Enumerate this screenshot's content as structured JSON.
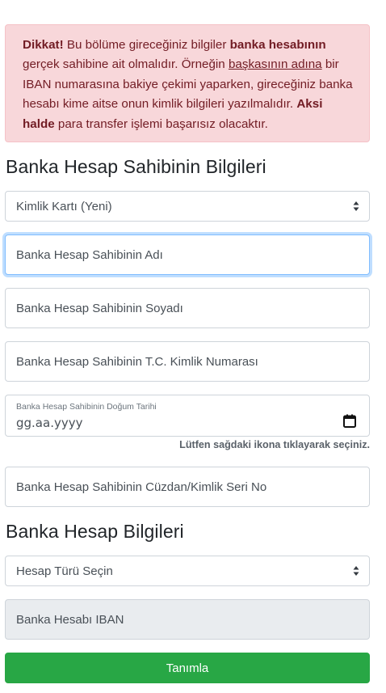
{
  "alert": {
    "lead": "Dikkat!",
    "text1": " Bu bölüme gireceğiniz bilgiler ",
    "bold1": "banka hesabının",
    "text2": " gerçek sahibine ait olmalıdır. Örneğin ",
    "underline": "başkasının adına",
    "text3": " bir IBAN numarasına bakiye çekimi yaparken, gireceğiniz banka hesabı kime aitse onun kimlik bilgileri yazılmalıdır. ",
    "bold2": "Aksi halde",
    "text4": " para transfer işlemi başarısız olacaktır."
  },
  "owner_section": {
    "title": "Banka Hesap Sahibinin Bilgileri",
    "id_type_select": "Kimlik Kartı (Yeni)",
    "first_name_placeholder": "Banka Hesap Sahibinin Adı",
    "last_name_placeholder": "Banka Hesap Sahibinin Soyadı",
    "tc_placeholder": "Banka Hesap Sahibinin T.C. Kimlik Numarası",
    "birth_date_label": "Banka Hesap Sahibinin Doğum Tarihi",
    "birth_date_value": "gg.aa.yyyy",
    "birth_date_hint": "Lütfen sağdaki ikona tıklayarak seçiniz.",
    "serial_placeholder": "Banka Hesap Sahibinin Cüzdan/Kimlik Seri No"
  },
  "account_section": {
    "title": "Banka Hesap Bilgileri",
    "account_type_select": "Hesap Türü Seçin",
    "iban_placeholder": "Banka Hesabı IBAN"
  },
  "submit_label": "Tanımla",
  "icons": {
    "select_caret": "chevron-up-down-icon",
    "date_picker": "calendar-icon"
  },
  "colors": {
    "alert_bg": "#f8d7da",
    "alert_text": "#721c24",
    "primary_button": "#28a745",
    "focus_ring": "#80bdff",
    "disabled_bg": "#e9ecef"
  }
}
